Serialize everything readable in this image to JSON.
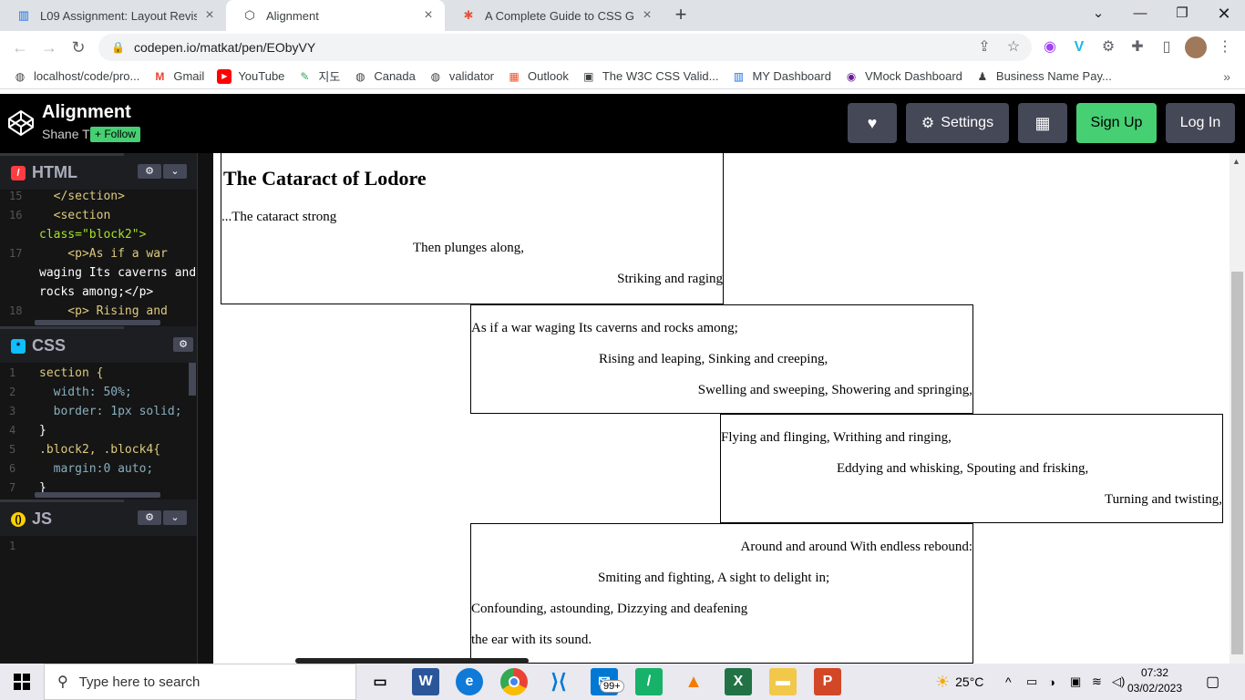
{
  "browser": {
    "tabs": [
      {
        "title": "L09 Assignment: Layout Revisited",
        "active": false
      },
      {
        "title": "Alignment",
        "active": true
      },
      {
        "title": "A Complete Guide to CSS Grid | C",
        "active": false
      }
    ],
    "url": "codepen.io/matkat/pen/EObyVY",
    "bookmarks": [
      {
        "label": "localhost/code/pro...",
        "icon": "globe-icon"
      },
      {
        "label": "Gmail",
        "icon": "gmail-icon"
      },
      {
        "label": "YouTube",
        "icon": "youtube-icon"
      },
      {
        "label": "지도",
        "icon": "maps-icon"
      },
      {
        "label": "Canada",
        "icon": "globe-icon"
      },
      {
        "label": "validator",
        "icon": "globe-icon"
      },
      {
        "label": "Outlook",
        "icon": "microsoft-icon"
      },
      {
        "label": "The W3C CSS Valid...",
        "icon": "w3c-icon"
      },
      {
        "label": "MY Dashboard",
        "icon": "chart-icon"
      },
      {
        "label": "VMock Dashboard",
        "icon": "vmock-icon"
      },
      {
        "label": "Business Name Pay...",
        "icon": "person-icon"
      }
    ]
  },
  "codepen": {
    "title": "Alignment",
    "author": "Shane T",
    "follow_label": "+ Follow",
    "settings_label": "Settings",
    "signup_label": "Sign Up",
    "login_label": "Log In"
  },
  "editors": {
    "html": {
      "label": "HTML",
      "lines": [
        {
          "n": "15",
          "text": "  </section>"
        },
        {
          "n": "16",
          "text": "  <section"
        },
        {
          "n": "",
          "text": "class=\"block2\">"
        },
        {
          "n": "17",
          "text": "    <p>As if a war"
        },
        {
          "n": "",
          "text": "waging Its caverns and"
        },
        {
          "n": "",
          "text": "rocks among;</p>"
        },
        {
          "n": "18",
          "text": "    <p> Rising and"
        }
      ]
    },
    "css": {
      "label": "CSS",
      "lines": [
        {
          "n": "1",
          "text": "section {"
        },
        {
          "n": "2",
          "text": "  width: 50%;"
        },
        {
          "n": "3",
          "text": "  border: 1px solid;"
        },
        {
          "n": "4",
          "text": "}"
        },
        {
          "n": "5",
          "text": ".block2, .block4{"
        },
        {
          "n": "6",
          "text": "  margin:0 auto;"
        },
        {
          "n": "7",
          "text": "}"
        }
      ]
    },
    "js": {
      "label": "JS",
      "lines": [
        {
          "n": "1",
          "text": ""
        }
      ]
    }
  },
  "preview": {
    "heading": "The Cataract of Lodore",
    "block1": [
      "...The cataract strong",
      "Then plunges along,",
      "Striking and raging"
    ],
    "block2": [
      "As if a war waging Its caverns and rocks among;",
      "Rising and leaping, Sinking and creeping,",
      "Swelling and sweeping, Showering and springing,"
    ],
    "block3": [
      "Flying and flinging, Writhing and ringing,",
      "Eddying and whisking, Spouting and frisking,",
      "Turning and twisting,"
    ],
    "block4": [
      "Around and around With endless rebound:",
      "Smiting and fighting, A sight to delight in;",
      "Confounding, astounding, Dizzying and deafening",
      "the ear with its sound."
    ]
  },
  "taskbar": {
    "search_placeholder": "Type here to search",
    "badge": "99+",
    "temperature": "25°C",
    "time": "07:32",
    "date": "03/02/2023"
  }
}
